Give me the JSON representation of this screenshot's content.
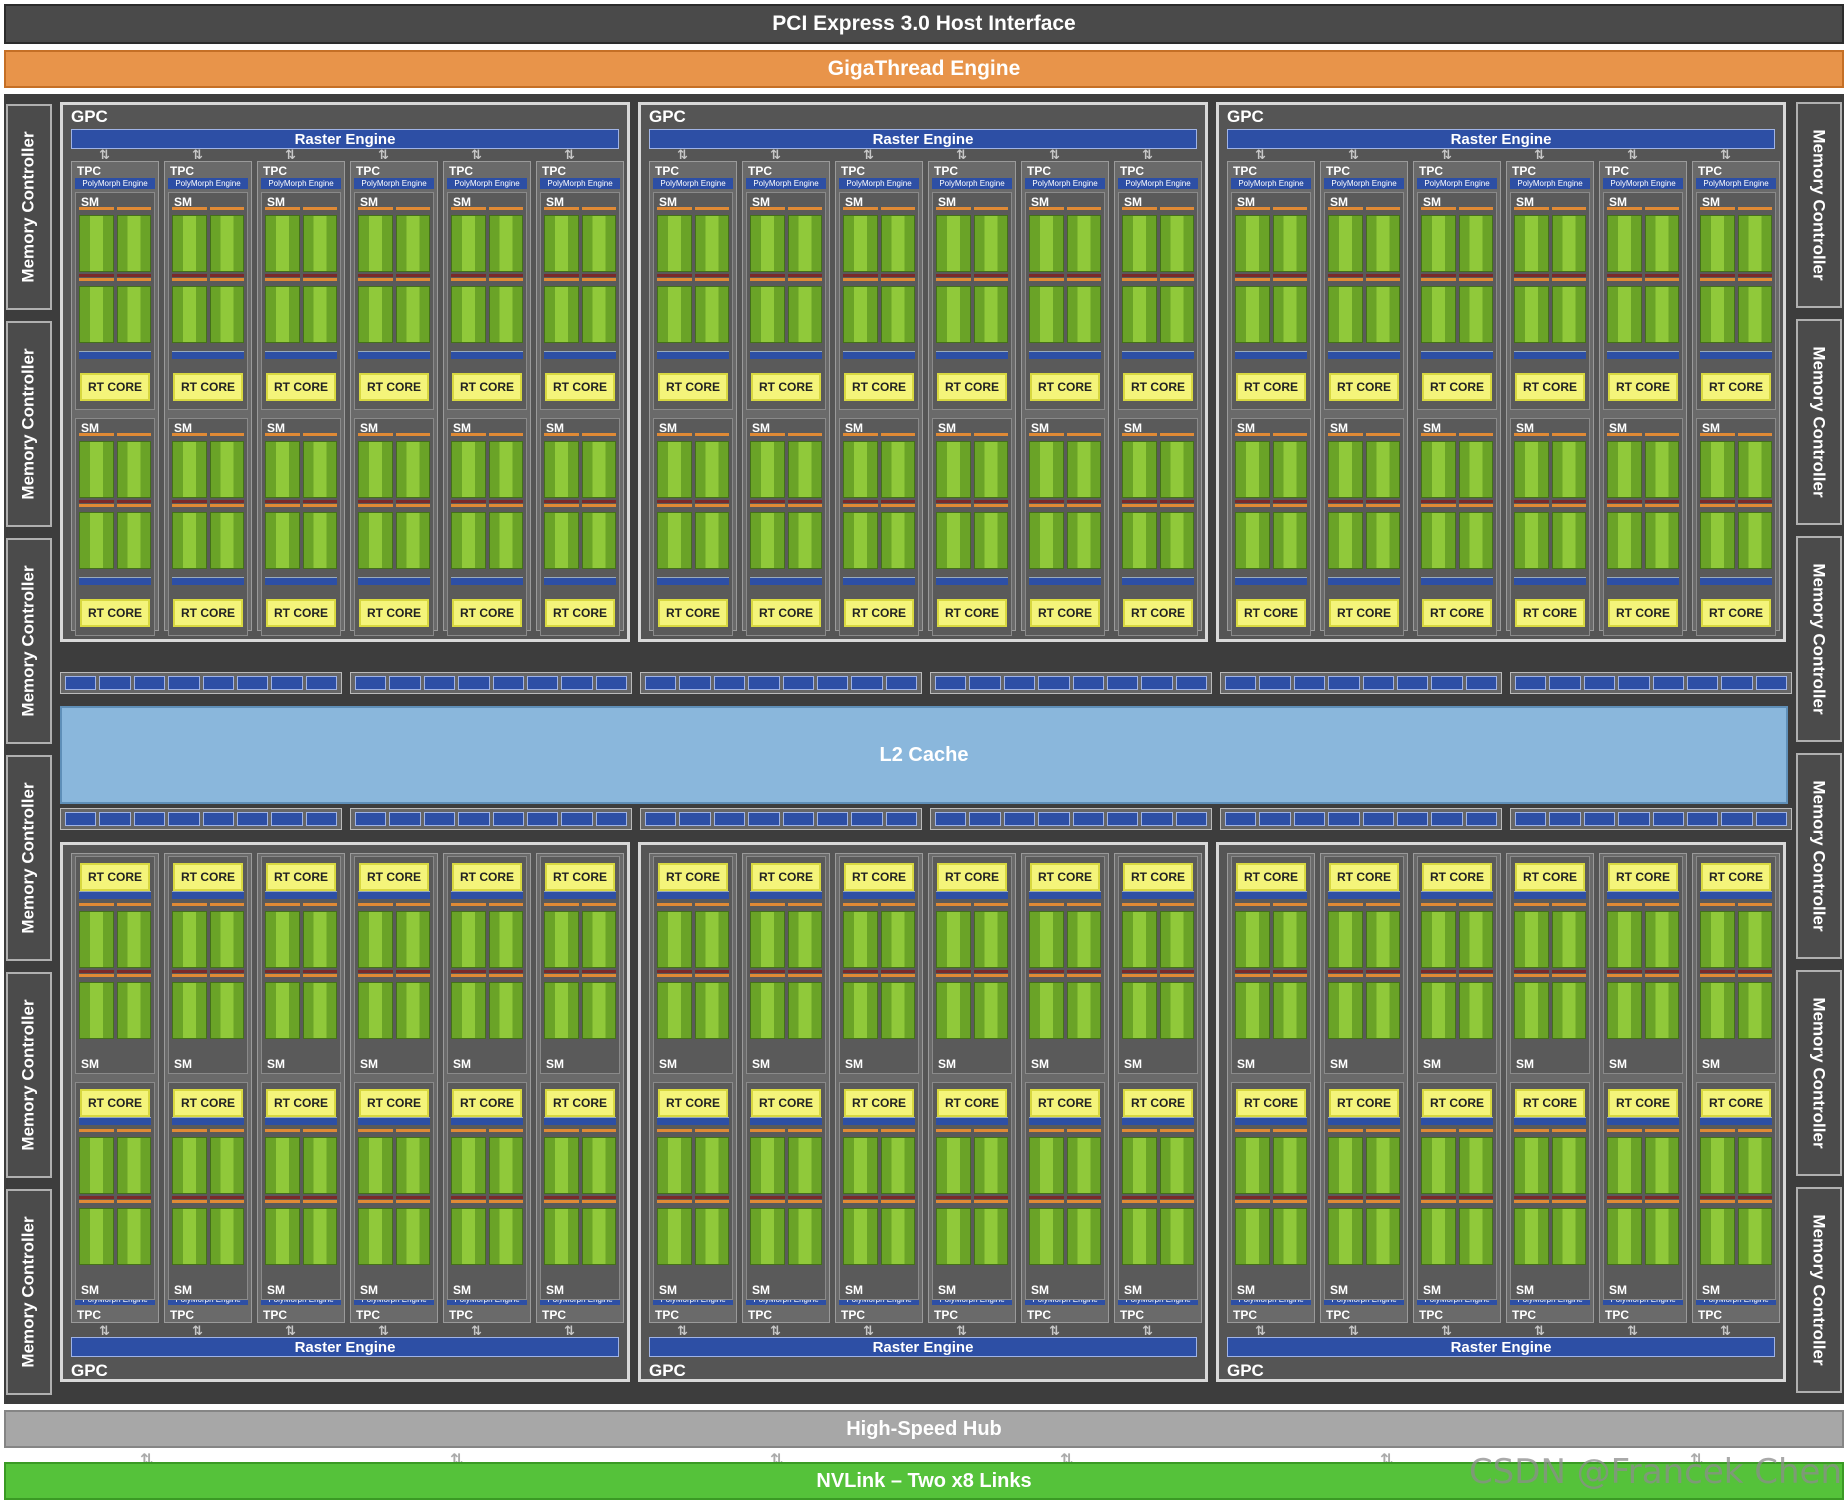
{
  "pcie_label": "PCI Express 3.0 Host Interface",
  "gigathread_label": "GigaThread Engine",
  "memory_controller_label": "Memory Controller",
  "gpc_label": "GPC",
  "raster_engine_label": "Raster Engine",
  "tpc_label": "TPC",
  "polymorph_label": "PolyMorph Engine",
  "sm_label": "SM",
  "rt_core_label": "RT CORE",
  "l2_cache_label": "L2 Cache",
  "hub_label": "High-Speed Hub",
  "nvlink_label": "NVLink – Two x8 Links",
  "watermark": "CSDN @Francek Chen",
  "layout": {
    "gpc_rows": 2,
    "gpcs_per_row": 3,
    "tpcs_per_gpc": 6,
    "sms_per_tpc": 2,
    "memory_controllers_per_side": 6
  },
  "colors": {
    "gigathread": "#e8944a",
    "raster": "#2d4fa5",
    "rt_core": "#f4f47a",
    "cuda_core": "#7ab62f",
    "l2": "#8ab7dc",
    "nvlink": "#55c23a",
    "hub": "#a7a7a7"
  }
}
